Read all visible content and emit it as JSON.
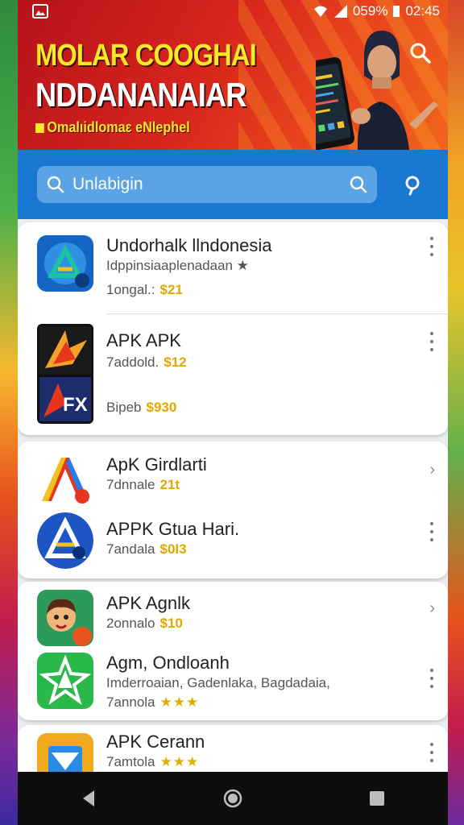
{
  "status_bar": {
    "battery": "059%",
    "time": "02:45"
  },
  "banner": {
    "title_line1": "MOLAR COOGHAI",
    "title_line2": "NDDANANAIAR",
    "subtitle": "Omalıidlomaɛ eNlephel"
  },
  "search": {
    "placeholder": "Unlabigin"
  },
  "apps": [
    {
      "title": "Undorhalk llndonesia",
      "line2": "Idppinsiaaplenadaan",
      "line3_label": "1ongal.:",
      "line3_value": "$21"
    },
    {
      "title": "APK APK",
      "line2_label": "7addold.",
      "line2_value": "$12",
      "line3_label": "Bipeb",
      "line3_value": "$930"
    },
    {
      "title": "ApK Girdlarti",
      "line2_label": "7dnnale",
      "line2_value": "21t"
    },
    {
      "title": "APPK Gtua Hari.",
      "line2_label": "7andala",
      "line2_value": "$0I3"
    },
    {
      "title": "APK Agnlk",
      "line2_label": "2onnalo",
      "line2_value": "$10"
    },
    {
      "title": "Agm, Ondloanh",
      "line2": "Imderroaian, Gadenlaka, Bagdadaia,",
      "line3_label": "7annola",
      "line3_stars": "★★★"
    },
    {
      "title": "APK Cerann",
      "line2_label": "7amtola",
      "line2_stars": "★★★"
    }
  ],
  "colors": {
    "accent_blue": "#1a77d2",
    "banner_red": "#d8261c",
    "price_gold": "#e0a800"
  }
}
